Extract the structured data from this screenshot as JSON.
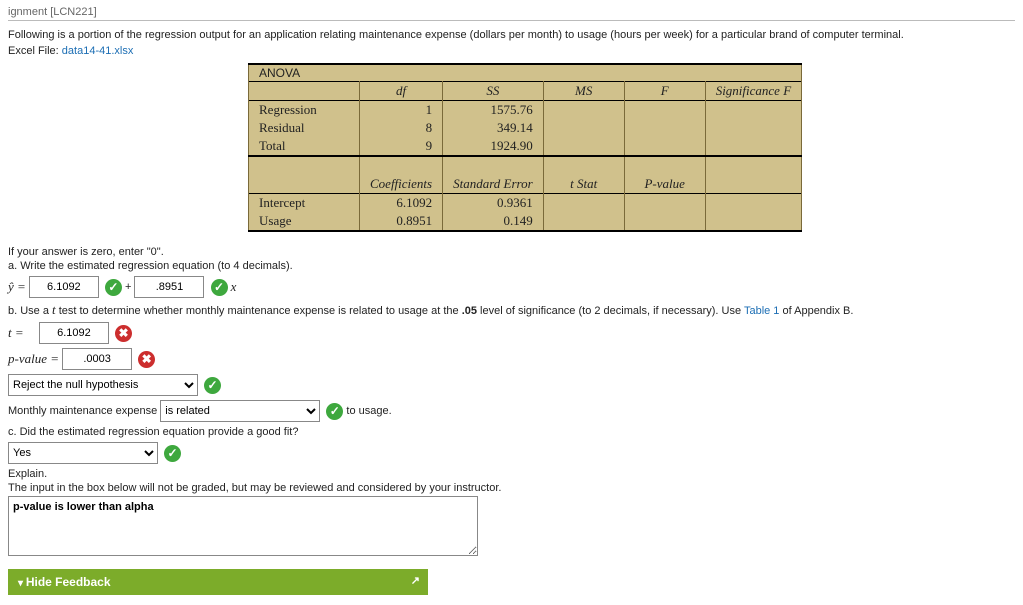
{
  "breadcrumb": "ignment [LCN221]",
  "intro": "Following is a portion of the regression output for an application relating maintenance expense (dollars per month) to usage (hours per week) for a particular brand of computer terminal.",
  "file_label": "Excel File: ",
  "file_link": "data14-41.xlsx",
  "anova": {
    "title": "ANOVA",
    "head": {
      "df": "df",
      "ss": "SS",
      "ms": "MS",
      "f": "F",
      "sigf": "Significance F"
    },
    "rows": {
      "reg": {
        "label": "Regression",
        "df": "1",
        "ss": "1575.76"
      },
      "res": {
        "label": "Residual",
        "df": "8",
        "ss": "349.14"
      },
      "tot": {
        "label": "Total",
        "df": "9",
        "ss": "1924.90"
      }
    },
    "coef_head": {
      "coef": "Coefficients",
      "se": "Standard Error",
      "tstat": "t Stat",
      "pval": "P-value"
    },
    "intercept": {
      "label": "Intercept",
      "coef": "6.1092",
      "se": "0.9361"
    },
    "usage": {
      "label": "Usage",
      "coef": "0.8951",
      "se": "0.149"
    }
  },
  "zero_note": "If your answer is zero, enter \"0\".",
  "part_a": "a. Write the estimated regression equation (to 4 decimals).",
  "eq": {
    "yhat": "ŷ =",
    "plus": " + ",
    "x": " x",
    "b0": "6.1092",
    "b1": ".8951"
  },
  "part_b_pre": "b. Use a ",
  "part_b_t": "t",
  "part_b_mid": " test to determine whether monthly maintenance expense is related to usage at the ",
  "part_b_alpha": ".05",
  "part_b_post": " level of significance (to 2 decimals, if necessary). Use ",
  "table1": "Table 1",
  "appendixB": " of Appendix B.",
  "t_eq": "t =",
  "t_val": "6.1092",
  "p_eq": "p-value =",
  "p_val": ".0003",
  "reject_sel": "Reject the null hypothesis",
  "monthly_pre": "Monthly maintenance expense ",
  "related_sel": "is related",
  "monthly_post": " to usage.",
  "part_c": "c. Did the estimated regression equation provide a good fit?",
  "yes_sel": "Yes",
  "explain_label": "Explain.",
  "explain_note": "The input in the box below will not be graded, but may be reviewed and considered by your instructor.",
  "explain_text": "p-value is lower than alpha",
  "feedback": "Hide Feedback"
}
